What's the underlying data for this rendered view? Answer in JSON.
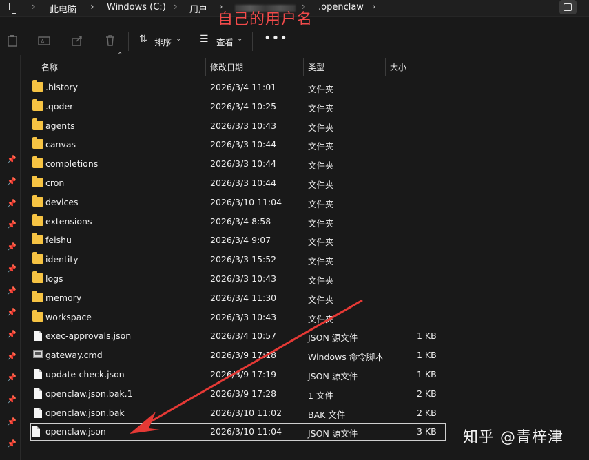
{
  "breadcrumb": {
    "items": [
      "此电脑",
      "Windows (C:)",
      "用户",
      ".openclaw"
    ],
    "annotation": "自己的用户名"
  },
  "toolbar": {
    "sort_label": "排序",
    "view_label": "查看",
    "more_label": "•••"
  },
  "columns": {
    "name": "名称",
    "date": "修改日期",
    "type": "类型",
    "size": "大小"
  },
  "files": [
    {
      "name": ".history",
      "date": "2026/3/4 11:01",
      "type": "文件夹",
      "size": "",
      "kind": "folder"
    },
    {
      "name": ".qoder",
      "date": "2026/3/4 10:25",
      "type": "文件夹",
      "size": "",
      "kind": "folder"
    },
    {
      "name": "agents",
      "date": "2026/3/3 10:43",
      "type": "文件夹",
      "size": "",
      "kind": "folder"
    },
    {
      "name": "canvas",
      "date": "2026/3/3 10:44",
      "type": "文件夹",
      "size": "",
      "kind": "folder"
    },
    {
      "name": "completions",
      "date": "2026/3/3 10:44",
      "type": "文件夹",
      "size": "",
      "kind": "folder"
    },
    {
      "name": "cron",
      "date": "2026/3/3 10:44",
      "type": "文件夹",
      "size": "",
      "kind": "folder"
    },
    {
      "name": "devices",
      "date": "2026/3/10 11:04",
      "type": "文件夹",
      "size": "",
      "kind": "folder"
    },
    {
      "name": "extensions",
      "date": "2026/3/4 8:58",
      "type": "文件夹",
      "size": "",
      "kind": "folder"
    },
    {
      "name": "feishu",
      "date": "2026/3/4 9:07",
      "type": "文件夹",
      "size": "",
      "kind": "folder"
    },
    {
      "name": "identity",
      "date": "2026/3/3 15:52",
      "type": "文件夹",
      "size": "",
      "kind": "folder"
    },
    {
      "name": "logs",
      "date": "2026/3/3 10:43",
      "type": "文件夹",
      "size": "",
      "kind": "folder"
    },
    {
      "name": "memory",
      "date": "2026/3/4 11:30",
      "type": "文件夹",
      "size": "",
      "kind": "folder"
    },
    {
      "name": "workspace",
      "date": "2026/3/3 10:43",
      "type": "文件夹",
      "size": "",
      "kind": "folder"
    },
    {
      "name": "exec-approvals.json",
      "date": "2026/3/4 10:57",
      "type": "JSON 源文件",
      "size": "1 KB",
      "kind": "file"
    },
    {
      "name": "gateway.cmd",
      "date": "2026/3/9 17:18",
      "type": "Windows 命令脚本",
      "size": "1 KB",
      "kind": "cmd"
    },
    {
      "name": "update-check.json",
      "date": "2026/3/9 17:19",
      "type": "JSON 源文件",
      "size": "1 KB",
      "kind": "file"
    },
    {
      "name": "openclaw.json.bak.1",
      "date": "2026/3/9 17:28",
      "type": "1 文件",
      "size": "2 KB",
      "kind": "file"
    },
    {
      "name": "openclaw.json.bak",
      "date": "2026/3/10 11:02",
      "type": "BAK 文件",
      "size": "2 KB",
      "kind": "file"
    },
    {
      "name": "openclaw.json",
      "date": "2026/3/10 11:04",
      "type": "JSON 源文件",
      "size": "3 KB",
      "kind": "file",
      "selected": true
    }
  ],
  "watermark": "知乎 @青梓津",
  "colors": {
    "background": "#191919",
    "folder": "#f6c343",
    "annotation": "#f24a4a",
    "arrow": "#e53935"
  }
}
